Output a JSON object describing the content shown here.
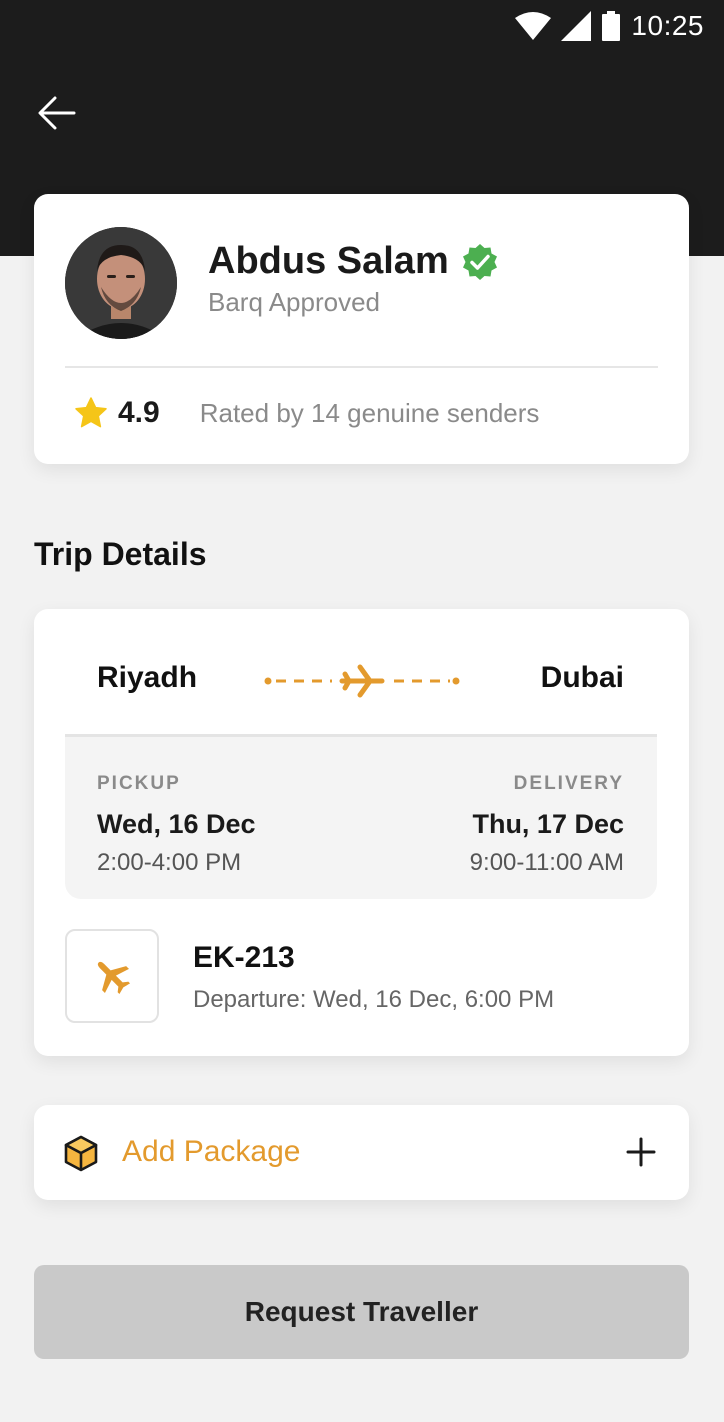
{
  "status_bar": {
    "time": "10:25",
    "icons": [
      "wifi-icon",
      "signal-icon",
      "battery-icon"
    ]
  },
  "header": {
    "back_icon": "arrow-left-icon",
    "background_color": "#1c1c1c"
  },
  "profile": {
    "name": "Abdus Salam",
    "verified_icon": "verified-badge-icon",
    "subtitle": "Barq Approved",
    "rating": "4.9",
    "rating_desc": "Rated by 14 genuine senders"
  },
  "trip": {
    "section_title": "Trip Details",
    "origin": "Riyadh",
    "destination": "Dubai",
    "pickup": {
      "label": "PICKUP",
      "date": "Wed, 16 Dec",
      "time": "2:00-4:00 PM"
    },
    "delivery": {
      "label": "DELIVERY",
      "date": "Thu, 17 Dec",
      "time": "9:00-11:00 AM"
    },
    "flight": {
      "number": "EK-213",
      "departure": "Departure: Wed, 16 Dec, 6:00 PM"
    }
  },
  "package": {
    "label": "Add Package",
    "icon": "package-icon",
    "action_icon": "plus-icon"
  },
  "cta": {
    "label": "Request Traveller"
  },
  "colors": {
    "accent": "#e39a2d",
    "verified": "#4caf50",
    "star": "#f5c518",
    "button_disabled": "#c9c9c9"
  }
}
